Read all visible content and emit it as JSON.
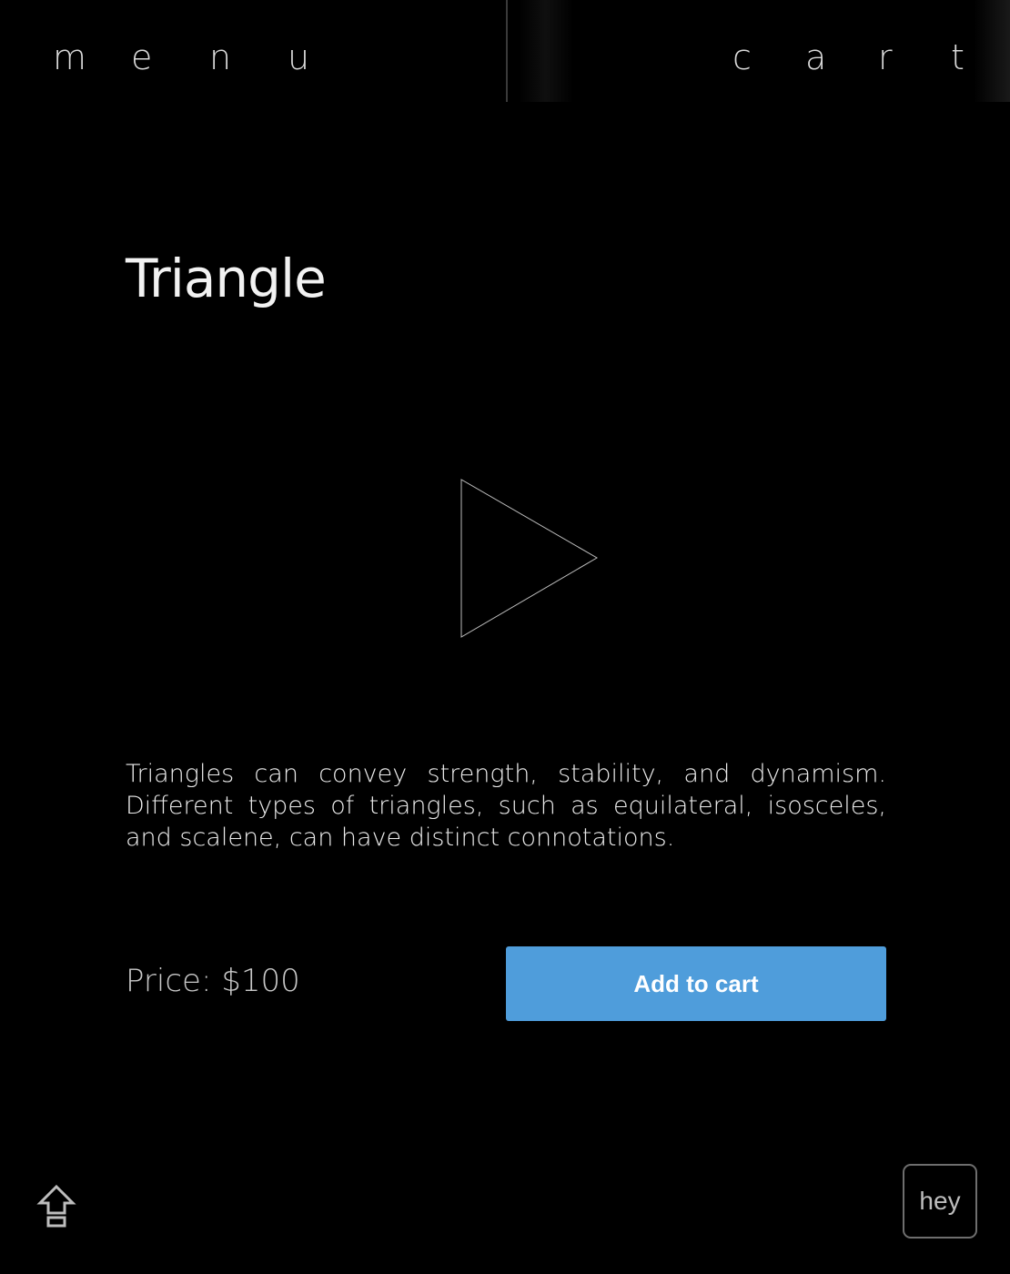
{
  "nav": {
    "menu_letters": [
      "m",
      "e",
      "n",
      "u"
    ],
    "cart_letters": [
      "c",
      "a",
      "r",
      "t"
    ]
  },
  "product": {
    "title": "Triangle",
    "shape_icon": "triangle-outline-icon",
    "description": "Triangles can convey strength, stability, and dynamism. Different types of triangles, such as equilateral, isosceles, and scalene, can have distinct connotations.",
    "price_text": "Price: $100",
    "add_to_cart_label": "Add to cart"
  },
  "footer": {
    "home_icon": "home-arrow-up-icon",
    "hey_label": "hey"
  },
  "colors": {
    "background": "#000000",
    "accent": "#4f9ddb",
    "text": "#f2f2f2",
    "muted": "#c8c8c8"
  }
}
